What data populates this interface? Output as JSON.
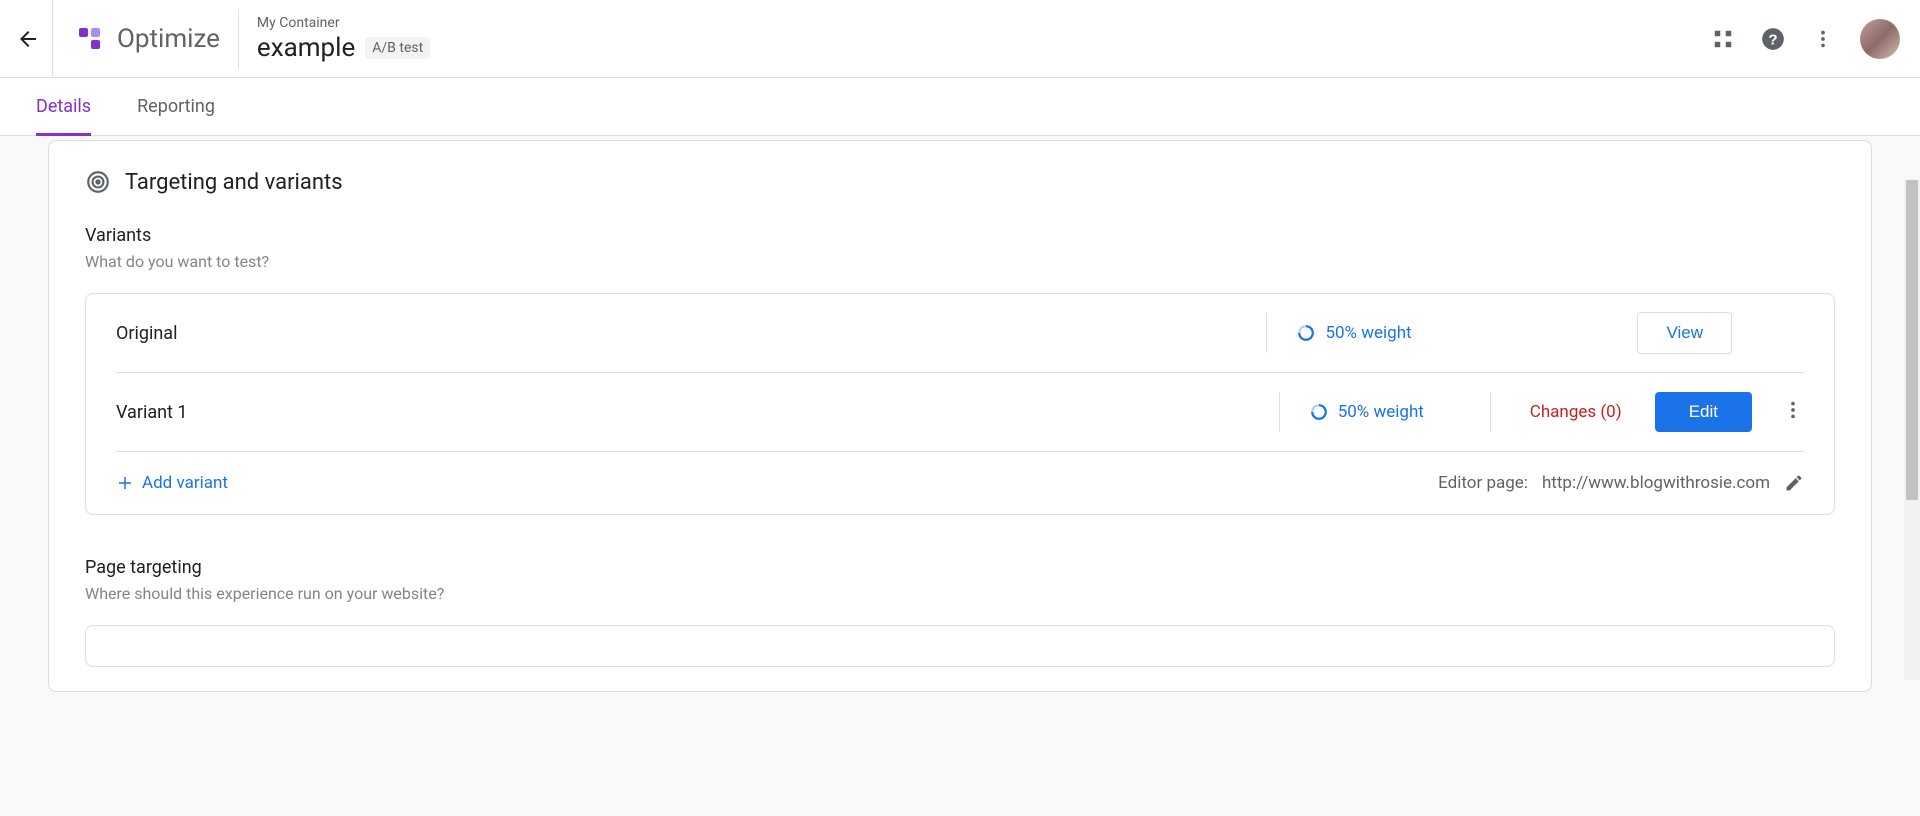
{
  "header": {
    "container_name": "My Container",
    "experiment_name": "example",
    "experiment_type": "A/B test",
    "brand": "Optimize"
  },
  "tabs": {
    "details": "Details",
    "reporting": "Reporting"
  },
  "section": {
    "title": "Targeting and variants"
  },
  "variants": {
    "title": "Variants",
    "desc": "What do you want to test?",
    "rows": [
      {
        "name": "Original",
        "weight": "50% weight",
        "changes": null
      },
      {
        "name": "Variant 1",
        "weight": "50% weight",
        "changes": "Changes (0)"
      }
    ],
    "add_label": "Add variant",
    "view_label": "View",
    "edit_label": "Edit",
    "editor_page_label": "Editor page:",
    "editor_page_url": "http://www.blogwithrosie.com"
  },
  "page_targeting": {
    "title": "Page targeting",
    "desc": "Where should this experience run on your website?"
  }
}
